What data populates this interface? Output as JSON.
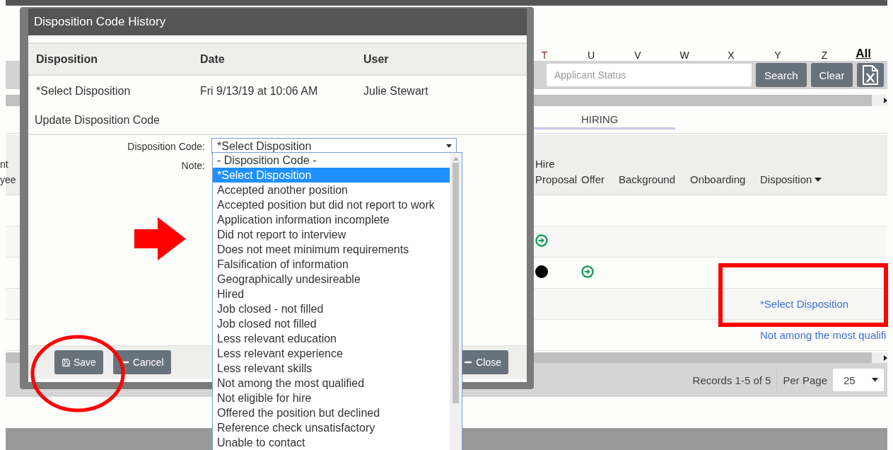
{
  "page": {
    "alphabet": [
      {
        "label": "T",
        "selected": true
      },
      {
        "label": "U",
        "selected": false
      },
      {
        "label": "V",
        "selected": false
      },
      {
        "label": "W",
        "selected": false
      },
      {
        "label": "X",
        "selected": false
      },
      {
        "label": "Y",
        "selected": false
      },
      {
        "label": "Z",
        "selected": false
      }
    ],
    "all_link": "All",
    "search": {
      "placeholder": "Applicant Status"
    },
    "buttons": [
      "Search",
      "Clear"
    ],
    "tabs": [
      {
        "label": "HIRING",
        "selected": true
      }
    ],
    "table": {
      "columns": [
        {
          "lines": [
            "nt",
            "yee"
          ]
        },
        {
          "lines": [
            "Hire",
            "Proposal"
          ]
        },
        {
          "lines": [
            "Offer"
          ]
        },
        {
          "lines": [
            "Background"
          ]
        },
        {
          "lines": [
            "Onboarding"
          ]
        },
        {
          "lines": [
            "Disposition"
          ],
          "sorted": true
        }
      ],
      "rows": [
        {},
        {
          "hire_proposal": {
            "kind": "arrow"
          }
        },
        {
          "hire_proposal": {
            "kind": "dot"
          },
          "offer": {
            "kind": "arrow"
          }
        },
        {
          "disposition": {
            "kind": "link",
            "text": "*Select Disposition"
          }
        },
        {
          "disposition": {
            "kind": "link",
            "text": "Not among the most qualifi"
          }
        }
      ]
    },
    "footer": {
      "records": "Records 1-5 of 5",
      "per_page_label": "Per Page",
      "per_page": "25"
    }
  },
  "modal": {
    "title": "Disposition Code History",
    "history": {
      "columns": [
        "Disposition",
        "Date",
        "User"
      ],
      "rows": [
        [
          "*Select Disposition",
          "Fri 9/13/19 at 10:06 AM",
          "Julie Stewart"
        ]
      ]
    },
    "section": "Update Disposition Code",
    "form": {
      "code_label": "Disposition Code:",
      "code_value": "*Select Disposition",
      "note_label": "Note:"
    },
    "options": [
      {
        "label": "- Disposition Code -",
        "selected": false
      },
      {
        "label": "*Select Disposition",
        "selected": true
      },
      {
        "label": "Accepted another position",
        "selected": false
      },
      {
        "label": "Accepted position but did not report to work",
        "selected": false
      },
      {
        "label": "Application information incomplete",
        "selected": false
      },
      {
        "label": "Did not report to interview",
        "selected": false
      },
      {
        "label": "Does not meet minimum requirements",
        "selected": false
      },
      {
        "label": "Falsification of information",
        "selected": false
      },
      {
        "label": "Geographically undesireable",
        "selected": false
      },
      {
        "label": "Hired",
        "selected": false
      },
      {
        "label": "Job closed - not filled",
        "selected": false
      },
      {
        "label": "Job closed not filled",
        "selected": false
      },
      {
        "label": "Less relevant education",
        "selected": false
      },
      {
        "label": "Less relevant experience",
        "selected": false
      },
      {
        "label": "Less relevant skills",
        "selected": false
      },
      {
        "label": "Not among the most qualified",
        "selected": false
      },
      {
        "label": "Not eligible for hire",
        "selected": false
      },
      {
        "label": "Offered the position but declined",
        "selected": false
      },
      {
        "label": "Reference check unsatisfactory",
        "selected": false
      },
      {
        "label": "Unable to contact",
        "selected": false
      }
    ],
    "buttons": [
      {
        "kind": "save",
        "label": "Save"
      },
      {
        "kind": "cancel",
        "label": "Cancel"
      },
      {
        "kind": "close",
        "label": "Close"
      }
    ]
  }
}
